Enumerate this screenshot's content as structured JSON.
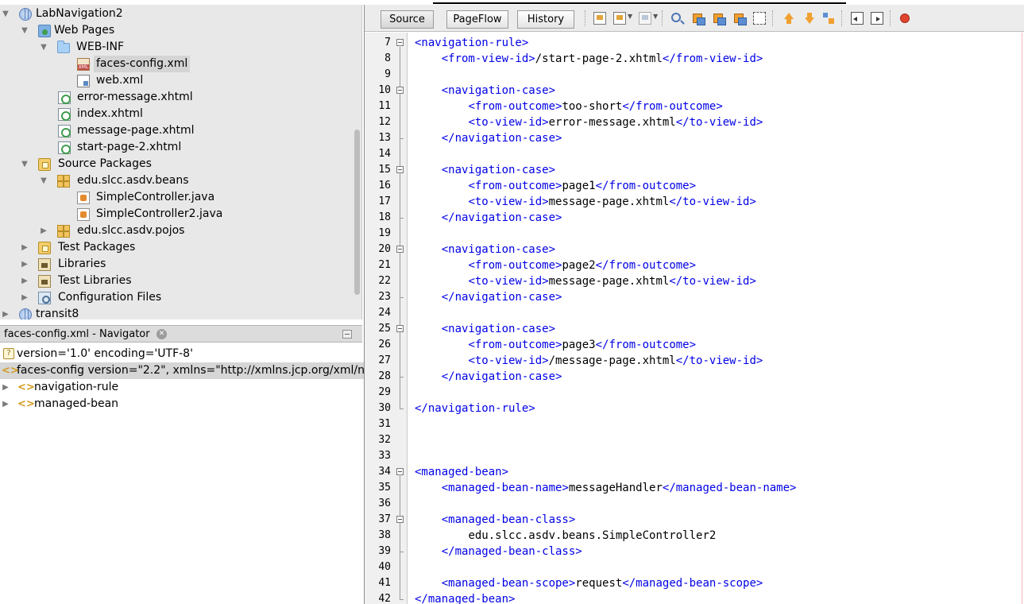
{
  "project_tree": {
    "items": [
      {
        "label": "LabNavigation2",
        "icon": "project-globe-icon",
        "expanded": true
      },
      {
        "label": "Web Pages",
        "icon": "web-pages-icon",
        "expanded": true
      },
      {
        "label": "WEB-INF",
        "icon": "folder-icon",
        "expanded": true
      },
      {
        "label": "faces-config.xml",
        "icon": "faces-config-file-icon",
        "selected": true
      },
      {
        "label": "web.xml",
        "icon": "xml-file-icon"
      },
      {
        "label": "error-message.xhtml",
        "icon": "xhtml-file-icon"
      },
      {
        "label": "index.xhtml",
        "icon": "xhtml-file-icon"
      },
      {
        "label": "message-page.xhtml",
        "icon": "xhtml-file-icon"
      },
      {
        "label": "start-page-2.xhtml",
        "icon": "xhtml-file-icon"
      },
      {
        "label": "Source Packages",
        "icon": "source-packages-icon",
        "expanded": true
      },
      {
        "label": "edu.slcc.asdv.beans",
        "icon": "package-icon",
        "expanded": true
      },
      {
        "label": "SimpleController.java",
        "icon": "java-file-icon"
      },
      {
        "label": "SimpleController2.java",
        "icon": "java-file-icon"
      },
      {
        "label": "edu.slcc.asdv.pojos",
        "icon": "package-icon",
        "expanded": false
      },
      {
        "label": "Test Packages",
        "icon": "test-packages-icon",
        "expanded": false
      },
      {
        "label": "Libraries",
        "icon": "libraries-icon",
        "expanded": false
      },
      {
        "label": "Test Libraries",
        "icon": "libraries-icon",
        "expanded": false
      },
      {
        "label": "Configuration Files",
        "icon": "configuration-files-icon",
        "expanded": false
      },
      {
        "label": "transit8",
        "icon": "project-globe-icon",
        "expanded": false
      }
    ]
  },
  "navigator": {
    "title": "faces-config.xml - Navigator",
    "items": [
      {
        "label": "version='1.0' encoding='UTF-8'",
        "icon": "xml-declaration-icon"
      },
      {
        "label": "faces-config version=\"2.2\", xmlns=\"http://xmlns.jcp.org/xml/n",
        "icon": "xml-element-icon",
        "selected": true
      },
      {
        "label": "navigation-rule",
        "icon": "xml-element-icon",
        "expanded": false
      },
      {
        "label": "managed-bean",
        "icon": "xml-element-icon",
        "expanded": false
      }
    ]
  },
  "editor": {
    "tabs": {
      "source": "Source",
      "pageflow": "PageFlow",
      "history": "History"
    },
    "line_numbers": [
      "7",
      "8",
      "9",
      "10",
      "11",
      "12",
      "13",
      "14",
      "15",
      "16",
      "17",
      "18",
      "19",
      "20",
      "21",
      "22",
      "23",
      "24",
      "25",
      "26",
      "27",
      "28",
      "29",
      "30",
      "31",
      "32",
      "33",
      "34",
      "35",
      "36",
      "37",
      "38",
      "39",
      "40",
      "41",
      "42"
    ],
    "lines": [
      {
        "indent": "",
        "tag1": "<navigation-rule>",
        "text": "",
        "tag2": ""
      },
      {
        "indent": "    ",
        "tag1": "<from-view-id>",
        "text": "/start-page-2.xhtml",
        "tag2": "</from-view-id>"
      },
      {
        "indent": "",
        "tag1": "",
        "text": "",
        "tag2": ""
      },
      {
        "indent": "    ",
        "tag1": "<navigation-case>",
        "text": "",
        "tag2": ""
      },
      {
        "indent": "        ",
        "tag1": "<from-outcome>",
        "text": "too-short",
        "tag2": "</from-outcome>"
      },
      {
        "indent": "        ",
        "tag1": "<to-view-id>",
        "text": "error-message.xhtml",
        "tag2": "</to-view-id>"
      },
      {
        "indent": "    ",
        "tag1": "</navigation-case>",
        "text": "",
        "tag2": ""
      },
      {
        "indent": "",
        "tag1": "",
        "text": "",
        "tag2": ""
      },
      {
        "indent": "    ",
        "tag1": "<navigation-case>",
        "text": "",
        "tag2": ""
      },
      {
        "indent": "        ",
        "tag1": "<from-outcome>",
        "text": "page1",
        "tag2": "</from-outcome>"
      },
      {
        "indent": "        ",
        "tag1": "<to-view-id>",
        "text": "message-page.xhtml",
        "tag2": "</to-view-id>"
      },
      {
        "indent": "    ",
        "tag1": "</navigation-case>",
        "text": "",
        "tag2": ""
      },
      {
        "indent": "",
        "tag1": "",
        "text": "",
        "tag2": ""
      },
      {
        "indent": "    ",
        "tag1": "<navigation-case>",
        "text": "",
        "tag2": ""
      },
      {
        "indent": "        ",
        "tag1": "<from-outcome>",
        "text": "page2",
        "tag2": "</from-outcome>"
      },
      {
        "indent": "        ",
        "tag1": "<to-view-id>",
        "text": "message-page.xhtml",
        "tag2": "</to-view-id>"
      },
      {
        "indent": "    ",
        "tag1": "</navigation-case>",
        "text": "",
        "tag2": ""
      },
      {
        "indent": "",
        "tag1": "",
        "text": "",
        "tag2": ""
      },
      {
        "indent": "    ",
        "tag1": "<navigation-case>",
        "text": "",
        "tag2": ""
      },
      {
        "indent": "        ",
        "tag1": "<from-outcome>",
        "text": "page3",
        "tag2": "</from-outcome>"
      },
      {
        "indent": "        ",
        "tag1": "<to-view-id>",
        "text": "/message-page.xhtml",
        "tag2": "</to-view-id>"
      },
      {
        "indent": "    ",
        "tag1": "</navigation-case>",
        "text": "",
        "tag2": ""
      },
      {
        "indent": "",
        "tag1": "",
        "text": "",
        "tag2": ""
      },
      {
        "indent": "",
        "tag1": "</navigation-rule>",
        "text": "",
        "tag2": ""
      },
      {
        "indent": "",
        "tag1": "",
        "text": "",
        "tag2": ""
      },
      {
        "indent": "",
        "tag1": "",
        "text": "",
        "tag2": ""
      },
      {
        "indent": "",
        "tag1": "",
        "text": "",
        "tag2": ""
      },
      {
        "indent": "",
        "tag1": "<managed-bean>",
        "text": "",
        "tag2": ""
      },
      {
        "indent": "    ",
        "tag1": "<managed-bean-name>",
        "text": "messageHandler",
        "tag2": "</managed-bean-name>"
      },
      {
        "indent": "",
        "tag1": "",
        "text": "",
        "tag2": ""
      },
      {
        "indent": "    ",
        "tag1": "<managed-bean-class>",
        "text": "",
        "tag2": ""
      },
      {
        "indent": "        ",
        "tag1": "",
        "text": "edu.slcc.asdv.beans.SimpleController2",
        "tag2": ""
      },
      {
        "indent": "    ",
        "tag1": "</managed-bean-class>",
        "text": "",
        "tag2": ""
      },
      {
        "indent": "",
        "tag1": "",
        "text": "",
        "tag2": ""
      },
      {
        "indent": "    ",
        "tag1": "<managed-bean-scope>",
        "text": "request",
        "tag2": "</managed-bean-scope>"
      },
      {
        "indent": "",
        "tag1": "</managed-bean>",
        "text": "",
        "tag2": ""
      }
    ]
  },
  "colors": {
    "tag": "#0000e6",
    "text": "#000000",
    "tree_background": "#e8e8e8",
    "selection": "#d4d4d4",
    "gutter": "#f0f0f0"
  }
}
